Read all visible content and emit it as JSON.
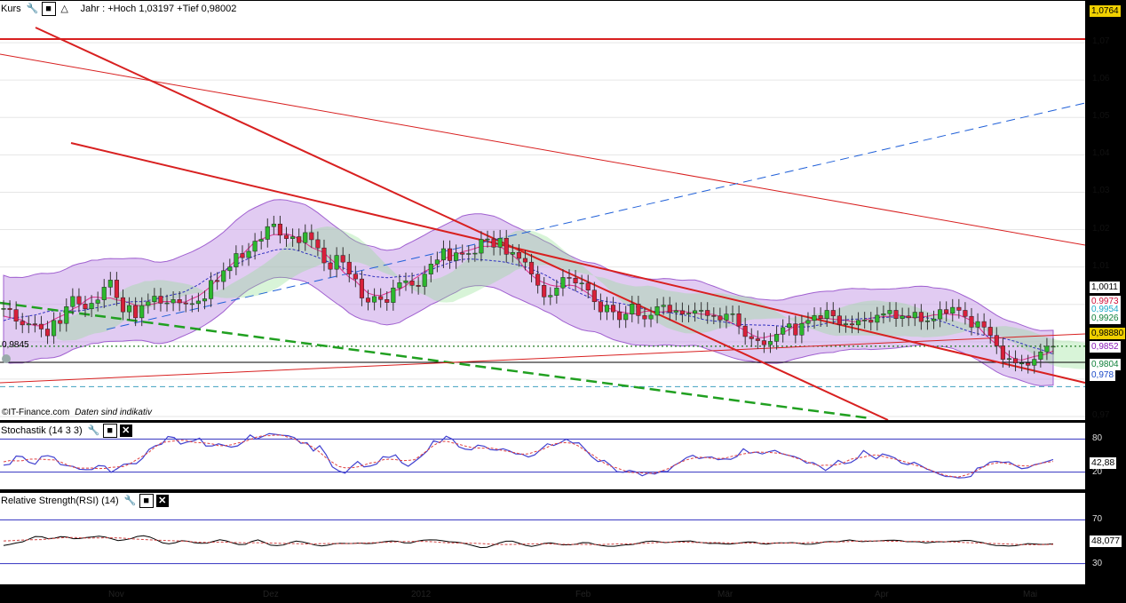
{
  "main_panel": {
    "title": "Kurs",
    "info": "Jahr : +Hoch 1,03197 +Tief 0,98002",
    "watermark": "©IT-Finance.com",
    "disclaimer": "Daten sind indikativ",
    "left_value_label": "0,9845",
    "price_badges": [
      {
        "label": "1,0764",
        "bg": "#f0d000",
        "fg": "#000"
      },
      {
        "label": "1,0011",
        "bg": "#ffffff",
        "fg": "#000"
      },
      {
        "label": "0,9973",
        "bg": "#ffffff",
        "fg": "#d0103a"
      },
      {
        "label": "0,9954",
        "bg": "#ffffff",
        "fg": "#1aa9c8"
      },
      {
        "label": "0,9926",
        "bg": "#ffffff",
        "fg": "#10803a"
      },
      {
        "label": "0,98880",
        "bg": "#f0d000",
        "fg": "#000"
      },
      {
        "label": "0,9852",
        "bg": "#ffffff",
        "fg": "#8a1ab8"
      },
      {
        "label": "0,9804",
        "bg": "#ffffff",
        "fg": "#10803a"
      },
      {
        "label": "0,978",
        "bg": "#ffffff",
        "fg": "#1a4ac8"
      }
    ]
  },
  "stoch_panel": {
    "title": "Stochastik (14 3 3)",
    "value_label": "42,88",
    "levels": [
      "80",
      "20"
    ]
  },
  "rsi_panel": {
    "title": "Relative Strength(RSI) (14)",
    "value_label": "48,077",
    "levels": [
      "70",
      "30"
    ]
  },
  "x_axis": {
    "labels": [
      "Nov",
      "Dez",
      "2012",
      "Feb",
      "Mär",
      "Apr",
      "Mai"
    ]
  },
  "colors": {
    "up_candle": "#2db82d",
    "down_candle": "#d8203a",
    "cloud": "#c8a0e8",
    "kumo_green": "#90e090",
    "kumo_cyan": "#8ee8f0",
    "trend_red": "#d82020",
    "trend_green": "#20a020",
    "trend_blue": "#2060d8",
    "stoch_k": "#4040d0",
    "stoch_d": "#e04040",
    "rsi": "#000000",
    "rsi_ma": "#d04040"
  },
  "chart_data": [
    {
      "type": "candlestick",
      "title": "Kurs",
      "subtitle": "Jahr : +Hoch 1,03197 +Tief 0,98002",
      "ylim": [
        0.97,
        1.08
      ],
      "y_ticks": [
        1.07,
        1.06,
        1.05,
        1.04,
        1.03,
        1.02,
        1.01,
        1.0,
        0.99,
        0.98,
        0.97
      ],
      "close": [
        0.9989,
        0.9986,
        0.9955,
        0.9945,
        0.9948,
        0.9947,
        0.9934,
        0.9916,
        0.9957,
        0.9949,
        0.9994,
        1.0021,
        1.0001,
        0.9988,
        1.0003,
        1.0012,
        1.0046,
        1.0065,
        1.0018,
        0.998,
        0.9997,
        0.9964,
        0.9997,
        1.0007,
        1.0022,
        1.0003,
        1.0004,
        1.0013,
        1.0004,
        1.0001,
        1.0002,
        1.0009,
        1.0015,
        1.0064,
        1.0061,
        1.009,
        1.01,
        1.0136,
        1.0125,
        1.0142,
        1.0169,
        1.0174,
        1.0208,
        1.0215,
        1.0185,
        1.0176,
        1.0181,
        1.0165,
        1.0192,
        1.0173,
        1.0151,
        1.0111,
        1.0094,
        1.0131,
        1.0113,
        1.0081,
        1.0068,
        1.0017,
        1.0006,
        1.0021,
        1.0013,
        1.0005,
        1.0044,
        1.0058,
        1.0063,
        1.0051,
        1.0048,
        1.0081,
        1.0108,
        1.0119,
        1.0149,
        1.0117,
        1.0138,
        1.0134,
        1.0136,
        1.0137,
        1.0174,
        1.0175,
        1.0153,
        1.0177,
        1.0134,
        1.0139,
        1.0123,
        1.0113,
        1.0081,
        1.0051,
        1.002,
        1.0024,
        1.0044,
        1.0072,
        1.007,
        1.0057,
        1.0057,
        1.0038,
        1.0007,
        0.998,
        0.9998,
        0.998,
        0.9959,
        0.9974,
        1.0001,
        0.997,
        0.9961,
        0.9971,
        0.9994,
        0.9998,
        0.9979,
        0.9983,
        0.9974,
        0.9976,
        0.9983,
        0.9984,
        0.997,
        0.9969,
        0.9958,
        0.9974,
        0.9975,
        0.9942,
        0.9914,
        0.9908,
        0.9903,
        0.9892,
        0.9901,
        0.992,
        0.9938,
        0.9948,
        0.9918,
        0.9949,
        0.9957,
        0.997,
        0.9962,
        0.9984,
        0.9969,
        0.9946,
        0.9948,
        0.9945,
        0.9957,
        0.9958,
        0.9952,
        0.9971,
        0.9975,
        0.9984,
        0.9962,
        0.9969,
        0.9964,
        0.9979,
        0.9954,
        0.9956,
        0.9961,
        0.9986,
        0.9976,
        0.9992,
        0.9984,
        0.9968,
        0.9939,
        0.9954,
        0.9939,
        0.9917,
        0.9889,
        0.9853,
        0.9855,
        0.9843,
        0.9843,
        0.9837,
        0.9853,
        0.9873,
        0.9888,
        0.9888
      ],
      "stoch_k": [
        32.6,
        34.2,
        49.1,
        48.0,
        37.9,
        34.3,
        48.3,
        49.9,
        46.8,
        33.7,
        31.8,
        30.3,
        25.1,
        24.4,
        24.6,
        31.8,
        31.0,
        19.6,
        26.5,
        34.2,
        35.4,
        35.3,
        45.2,
        61.2,
        67.9,
        70.6,
        84.6,
        82.7,
        70.8,
        74.5,
        76.6,
        81.6,
        67.3,
        67.4,
        71.3,
        68.3,
        65.3,
        67.5,
        75.4,
        87.4,
        80.0,
        84.7,
        89.9,
        88.6,
        87.0,
        86.1,
        82.7,
        72.4,
        73.2,
        58.3,
        67.9,
        51.9,
        29.5,
        22.3,
        18.1,
        29.6,
        39.3,
        29.5,
        31.0,
        34.7,
        48.0,
        46.7,
        51.3,
        36.8,
        30.6,
        39.1,
        48.2,
        58.2,
        77.0,
        73.4,
        85.1,
        79.7,
        65.9,
        61.7,
        60.5,
        68.9,
        67.1,
        60.8,
        59.9,
        62.4,
        58.6,
        53.0,
        52.5,
        47.5,
        51.2,
        61.5,
        71.4,
        68.3,
        73.2,
        79.8,
        72.9,
        73.2,
        61.1,
        48.1,
        39.2,
        41.3,
        32.6,
        20.8,
        19.8,
        23.2,
        20.2,
        13.3,
        18.2,
        16.6,
        21.4,
        21.0,
        31.8,
        38.0,
        46.2,
        50.5,
        44.5,
        46.9,
        47.5,
        42.5,
        43.9,
        43.1,
        48.4,
        62.5,
        54.5,
        56.3,
        53.0,
        56.9,
        59.5,
        53.8,
        50.7,
        48.5,
        44.0,
        36.4,
        37.3,
        31.0,
        23.0,
        30.8,
        41.3,
        35.3,
        37.4,
        44.4,
        59.1,
        51.3,
        43.8,
        52.9,
        49.8,
        45.6,
        36.4,
        33.5,
        37.8,
        32.2,
        25.5,
        21.7,
        16.1,
        12.0,
        11.8,
        9.5,
        10.0,
        12.1,
        27.4,
        29.6,
        38.0,
        39.6,
        37.5,
        38.6,
        32.0,
        26.3,
        27.8,
        33.3,
        35.8,
        39.2,
        42.9
      ],
      "rsi": [
        46.5,
        47.6,
        48.9,
        49.9,
        52.4,
        54.8,
        54.6,
        52.8,
        53.3,
        54.7,
        54.3,
        52.7,
        52.9,
        53.9,
        54.4,
        55.1,
        54.3,
        52.7,
        51.0,
        51.7,
        52.8,
        54.8,
        55.5,
        54.3,
        51.8,
        49.0,
        48.1,
        49.1,
        51.0,
        50.4,
        49.1,
        48.6,
        48.7,
        50.3,
        51.8,
        50.8,
        49.0,
        47.4,
        47.6,
        50.2,
        51.7,
        49.4,
        46.8,
        46.4,
        47.0,
        49.1,
        50.6,
        49.8,
        48.5,
        46.9,
        46.1,
        46.8,
        48.2,
        48.6,
        48.4,
        48.5,
        48.8,
        48.3,
        48.5,
        49.3,
        50.1,
        50.7,
        50.3,
        49.0,
        48.9,
        50.5,
        51.4,
        51.7,
        51.6,
        50.9,
        50.0,
        49.7,
        49.0,
        47.6,
        46.1,
        44.6,
        44.9,
        46.9,
        49.0,
        50.5,
        50.5,
        48.7,
        46.7,
        45.7,
        46.8,
        48.5,
        49.0,
        48.0,
        47.1,
        47.2,
        47.8,
        49.2,
        49.1,
        47.5,
        46.5,
        45.8,
        45.8,
        46.6,
        47.2,
        47.6,
        48.9,
        50.2,
        50.6,
        50.0,
        49.2,
        49.6,
        50.2,
        50.5,
        50.7,
        49.6,
        49.1,
        48.4,
        48.6,
        48.2,
        47.8,
        48.4,
        49.1,
        49.8,
        49.7,
        48.3,
        47.8,
        48.7,
        49.0,
        48.9,
        49.2,
        48.6,
        47.7,
        47.8,
        48.6,
        49.8,
        50.2,
        49.9,
        50.8,
        51.6,
        50.7,
        50.1,
        50.5,
        50.6,
        50.9,
        51.3,
        51.4,
        51.0,
        50.0,
        50.1,
        49.8,
        48.9,
        49.5,
        50.0,
        49.8,
        50.5,
        50.5,
        51.2,
        51.1,
        50.0,
        49.1,
        47.5,
        46.5,
        46.4,
        46.0,
        46.3,
        47.2,
        48.3,
        48.0,
        47.6,
        47.7,
        48.1
      ],
      "stoch_levels": [
        80,
        20
      ],
      "rsi_levels": [
        70,
        30
      ],
      "last_stoch": 42.88,
      "last_rsi": 48.077,
      "last_price": 0.9888
    }
  ]
}
